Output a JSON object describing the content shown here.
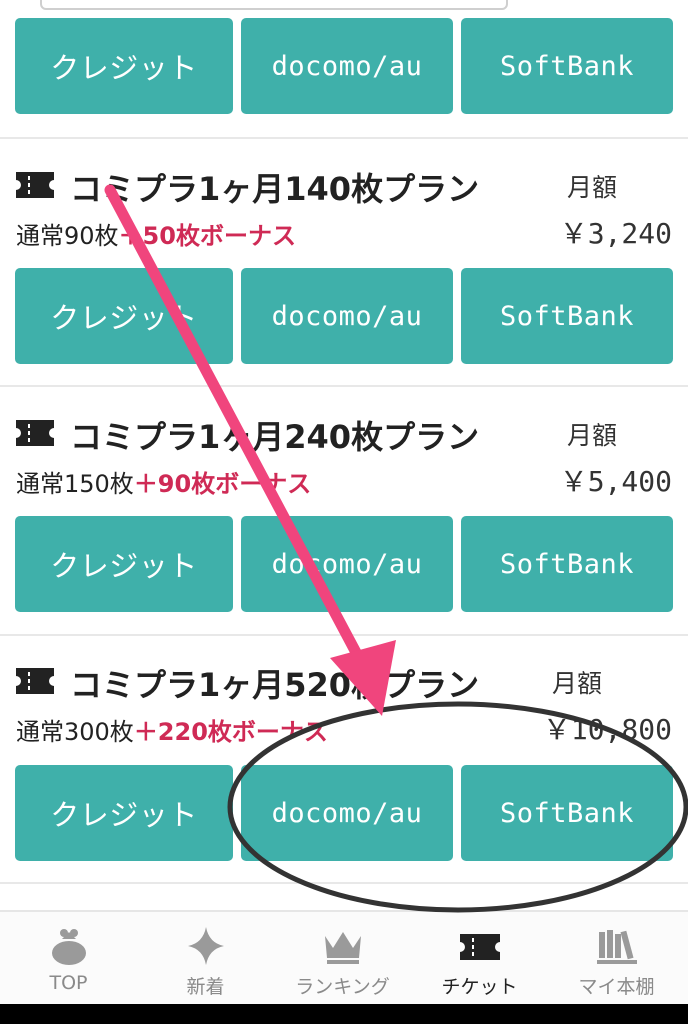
{
  "payment_buttons": {
    "credit": "クレジット",
    "docomo": "docomo/au",
    "softbank": "SoftBank"
  },
  "monthly_label": "月額",
  "plans": [
    {
      "title": "コミプラ1ヶ月140枚プラン",
      "normal": "通常90枚",
      "bonus": "＋50枚ボーナス",
      "price": "￥3,240"
    },
    {
      "title": "コミプラ1ヶ月240枚プラン",
      "normal": "通常150枚",
      "bonus": "＋90枚ボーナス",
      "price": "￥5,400"
    },
    {
      "title": "コミプラ1ヶ月520枚プラン",
      "normal": "通常300枚",
      "bonus": "＋220枚ボーナス",
      "price": "￥10,800"
    }
  ],
  "nav": [
    {
      "label": "TOP",
      "icon": "money-bag-icon"
    },
    {
      "label": "新着",
      "icon": "sparkle-icon"
    },
    {
      "label": "ランキング",
      "icon": "crown-icon"
    },
    {
      "label": "チケット",
      "icon": "ticket-icon",
      "active": true
    },
    {
      "label": "マイ本棚",
      "icon": "bookshelf-icon"
    }
  ],
  "colors": {
    "button": "#3fb0aa",
    "bonus": "#cf2a55",
    "arrow": "#f0457d",
    "annotation_circle": "#333333"
  }
}
